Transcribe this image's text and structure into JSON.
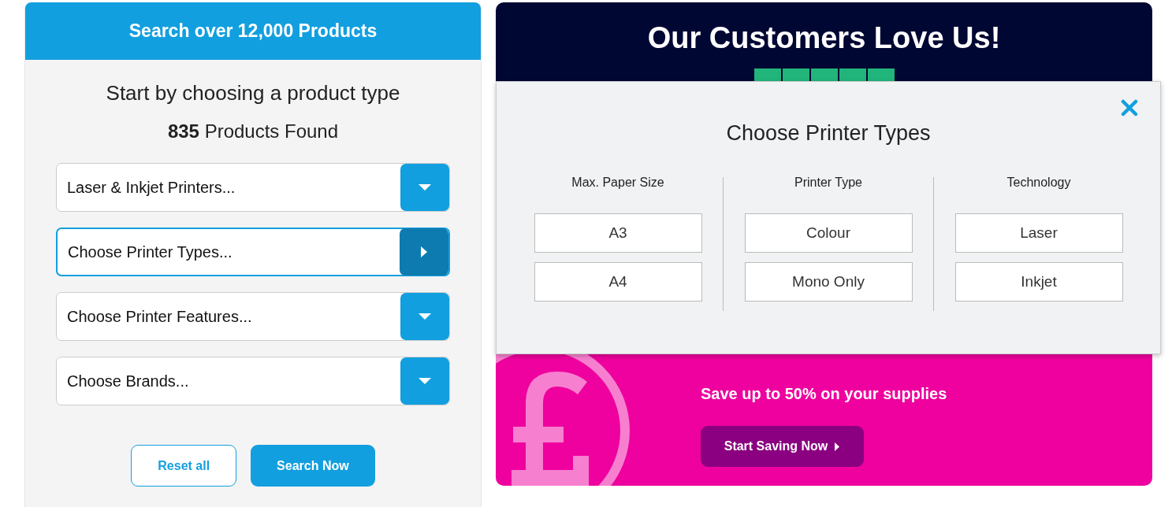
{
  "search_panel": {
    "header": "Search over 12,000 Products",
    "heading": "Start by choosing a product type",
    "count": "835",
    "count_label": "Products Found",
    "dropdowns": [
      {
        "label": "Laser & Inkjet Printers...",
        "expanded": false
      },
      {
        "label": "Choose Printer Types...",
        "expanded": true
      },
      {
        "label": "Choose Printer Features...",
        "expanded": false
      },
      {
        "label": "Choose Brands...",
        "expanded": false
      }
    ],
    "buttons": [
      {
        "label": "Reset all",
        "kind": "outline"
      },
      {
        "label": "Search Now",
        "kind": "primary"
      }
    ]
  },
  "promo": {
    "title": "Our Customers Love Us!",
    "subline": "Save up to 50% on your supplies",
    "button": "Start Saving Now"
  },
  "popup": {
    "title": "Choose Printer Types",
    "columns": [
      {
        "heading": "Max. Paper Size",
        "options": [
          {
            "label": "A3",
            "selected": false
          },
          {
            "label": "A4",
            "selected": false
          }
        ]
      },
      {
        "heading": "Printer Type",
        "options": [
          {
            "label": "Colour",
            "selected": false
          },
          {
            "label": "Mono Only",
            "selected": false
          }
        ]
      },
      {
        "heading": "Technology",
        "options": [
          {
            "label": "Laser",
            "selected": false
          },
          {
            "label": "Inkjet",
            "selected": false
          }
        ]
      }
    ]
  }
}
